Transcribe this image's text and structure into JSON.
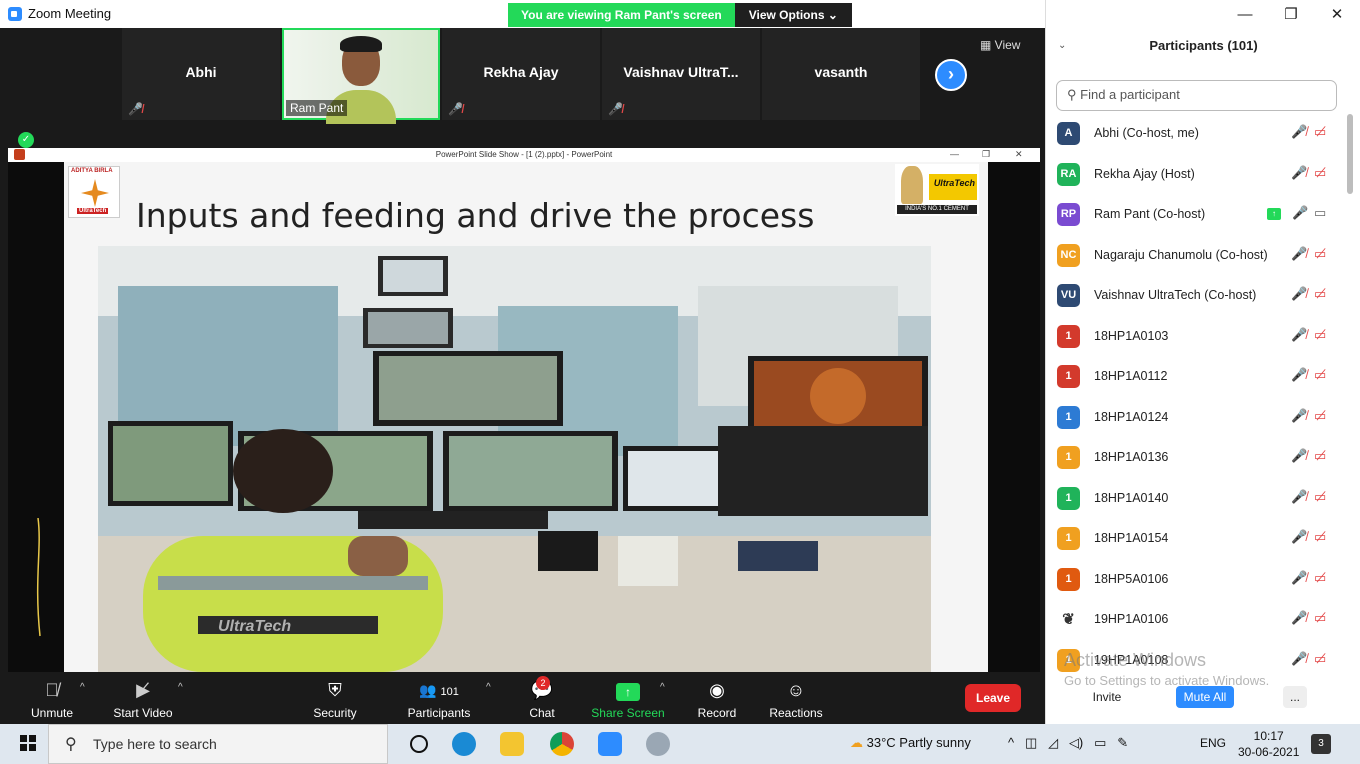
{
  "window": {
    "title": "Zoom Meeting"
  },
  "banner": {
    "viewing_text": "You are viewing Ram Pant's screen",
    "view_options": "View Options ⌄"
  },
  "gallery": {
    "tiles": [
      "Abhi",
      "Ram Pant",
      "Rekha Ajay",
      "Vaishnav UltraT...",
      "vasanth"
    ],
    "view_label": "View"
  },
  "share": {
    "window_title": "PowerPoint Slide Show - [1 (2).pptx] - PowerPoint",
    "slide_title": "Inputs and feeding and drive the process",
    "logo_left_text": "ADITYA BIRLA",
    "logo_left_sub": "UltraTech",
    "logo_right_text": "UltraTech",
    "logo_right_tag": "INDIA'S NO.1 CEMENT",
    "jacket_text": "UltraTech"
  },
  "toolbar": {
    "unmute": "Unmute",
    "start_video": "Start Video",
    "security": "Security",
    "participants": "Participants",
    "participants_count": "101",
    "chat": "Chat",
    "chat_badge": "2",
    "share_screen": "Share Screen",
    "record": "Record",
    "reactions": "Reactions",
    "leave": "Leave"
  },
  "panel": {
    "title": "Participants (101)",
    "search_placeholder": "Find a participant",
    "participants": [
      {
        "initials": "A",
        "name": "Abhi (Co-host, me)",
        "color": "#2e4a73"
      },
      {
        "initials": "RA",
        "name": "Rekha Ajay (Host)",
        "color": "#20b35a"
      },
      {
        "initials": "RP",
        "name": "Ram Pant (Co-host)",
        "color": "#7a4bd1"
      },
      {
        "initials": "NC",
        "name": "Nagaraju Chanumolu (Co-host)",
        "color": "#f0a020"
      },
      {
        "initials": "VU",
        "name": "Vaishnav UltraTech (Co-host)",
        "color": "#2e4a73"
      },
      {
        "initials": "1",
        "name": "18HP1A0103",
        "color": "#d33a2c"
      },
      {
        "initials": "1",
        "name": "18HP1A0112",
        "color": "#d33a2c"
      },
      {
        "initials": "1",
        "name": "18HP1A0124",
        "color": "#2d7bd4"
      },
      {
        "initials": "1",
        "name": "18HP1A0136",
        "color": "#f0a020"
      },
      {
        "initials": "1",
        "name": "18HP1A0140",
        "color": "#20b35a"
      },
      {
        "initials": "1",
        "name": "18HP1A0154",
        "color": "#f0a020"
      },
      {
        "initials": "1",
        "name": "18HP5A0106",
        "color": "#e05a10"
      },
      {
        "initials": "",
        "name": "19HP1A0106",
        "color": "#ffffff"
      },
      {
        "initials": "1",
        "name": "19HP1A0108",
        "color": "#f0a020"
      }
    ],
    "activate_title": "Activate Windows",
    "activate_sub": "Go to Settings to activate Windows.",
    "invite": "Invite",
    "mute_all": "Mute All",
    "more": "..."
  },
  "taskbar": {
    "search_placeholder": "Type here to search",
    "weather": "33°C  Partly sunny",
    "language": "ENG",
    "time": "10:17",
    "date": "30-06-2021",
    "notifications": "3"
  }
}
